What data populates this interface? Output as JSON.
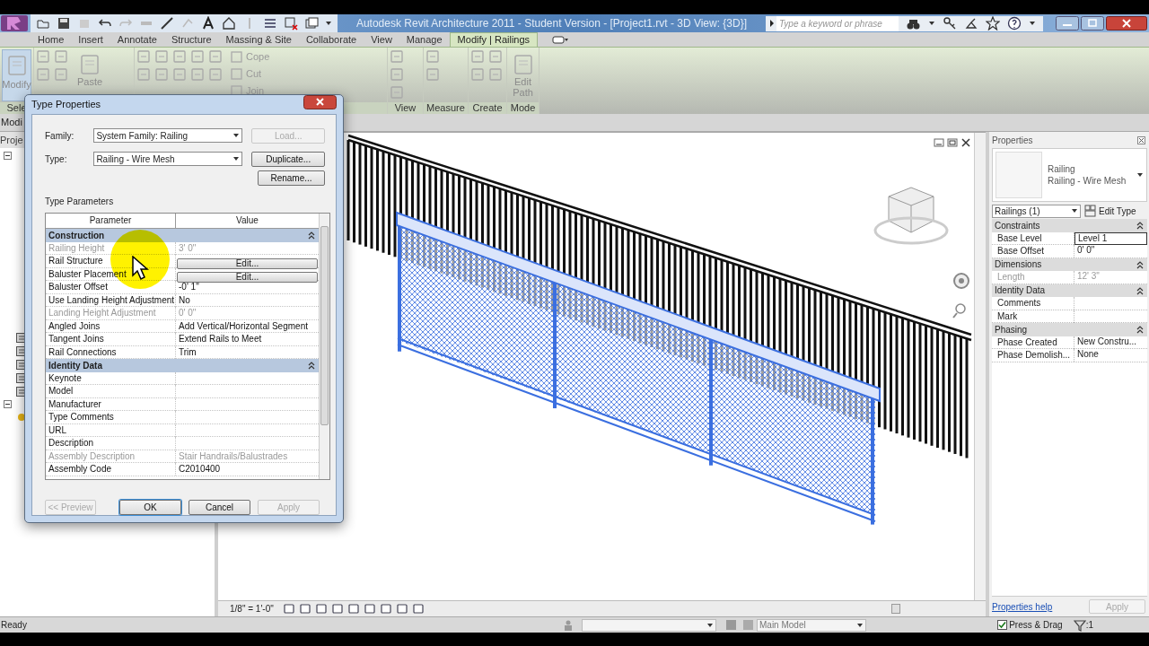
{
  "title_bar": {
    "title": "Autodesk Revit Architecture 2011 - Student Version - [Project1.rvt - 3D View: {3D}]",
    "search": {
      "placeholder": "Type a keyword or phrase"
    }
  },
  "ribbon": {
    "tabs": [
      {
        "label": "Home",
        "selected": false
      },
      {
        "label": "Insert",
        "selected": false
      },
      {
        "label": "Annotate",
        "selected": false
      },
      {
        "label": "Structure",
        "selected": false
      },
      {
        "label": "Massing & Site",
        "selected": false
      },
      {
        "label": "Collaborate",
        "selected": false
      },
      {
        "label": "View",
        "selected": false
      },
      {
        "label": "Manage",
        "selected": false
      },
      {
        "label": "Modify | Railings",
        "selected": true
      }
    ],
    "panels": [
      {
        "label": "Sele",
        "tools": [
          {
            "kind": "large",
            "label": "Modify"
          }
        ]
      },
      {
        "tools": [
          {
            "kind": "large",
            "label": "Paste"
          }
        ]
      },
      {
        "tools": [
          {
            "kind": "small",
            "label": "Cope"
          },
          {
            "kind": "small",
            "label": "Cut"
          },
          {
            "kind": "small",
            "label": "Join"
          }
        ]
      },
      {
        "label": "View"
      },
      {
        "label": "Measure"
      },
      {
        "label": "Create"
      },
      {
        "label": "Mode",
        "tools": [
          {
            "kind": "large",
            "label": "Edit Path"
          }
        ]
      }
    ]
  },
  "options_bar": {
    "label": "Modi"
  },
  "project_browser": {
    "title": "Proje"
  },
  "view": {
    "scale": "1/8\" = 1'-0\""
  },
  "type_properties": {
    "title": "Type Properties",
    "family": {
      "label": "Family:",
      "value": "System Family: Railing"
    },
    "type": {
      "label": "Type:",
      "value": "Railing - Wire Mesh"
    },
    "buttons": [
      {
        "label": "Load...",
        "disabled": true
      },
      {
        "label": "Duplicate...",
        "disabled": false
      },
      {
        "label": "Rename...",
        "disabled": false
      }
    ],
    "section_label": "Type Parameters",
    "columns": [
      "Parameter",
      "Value"
    ],
    "groups": [
      {
        "name": "Construction",
        "expanded": true,
        "rows": [
          {
            "parameter": "Railing Height",
            "value": "3' 0\"",
            "disabled": true,
            "kind": "text"
          },
          {
            "parameter": "Rail Structure",
            "value": "Edit...",
            "disabled": false,
            "kind": "button"
          },
          {
            "parameter": "Baluster Placement",
            "value": "Edit...",
            "disabled": false,
            "kind": "button"
          },
          {
            "parameter": "Baluster Offset",
            "value": "-0' 1\"",
            "disabled": false,
            "kind": "text"
          },
          {
            "parameter": "Use Landing Height Adjustment",
            "value": "No",
            "disabled": false,
            "kind": "text"
          },
          {
            "parameter": "Landing Height Adjustment",
            "value": "0' 0\"",
            "disabled": true,
            "kind": "text"
          },
          {
            "parameter": "Angled Joins",
            "value": "Add Vertical/Horizontal Segment",
            "disabled": false,
            "kind": "text"
          },
          {
            "parameter": "Tangent Joins",
            "value": "Extend Rails to Meet",
            "disabled": false,
            "kind": "text"
          },
          {
            "parameter": "Rail Connections",
            "value": "Trim",
            "disabled": false,
            "kind": "text"
          }
        ]
      },
      {
        "name": "Identity Data",
        "expanded": true,
        "rows": [
          {
            "parameter": "Keynote",
            "disabled": false,
            "kind": "text"
          },
          {
            "parameter": "Model",
            "disabled": false,
            "kind": "text"
          },
          {
            "parameter": "Manufacturer",
            "disabled": false,
            "kind": "text"
          },
          {
            "parameter": "Type Comments",
            "disabled": false,
            "kind": "text"
          },
          {
            "parameter": "URL",
            "disabled": false,
            "kind": "text"
          },
          {
            "parameter": "Description",
            "disabled": false,
            "kind": "text"
          },
          {
            "parameter": "Assembly Description",
            "value": "Stair Handrails/Balustrades",
            "disabled": true,
            "kind": "text"
          },
          {
            "parameter": "Assembly Code",
            "value": "C2010400",
            "disabled": false,
            "kind": "text"
          }
        ]
      }
    ],
    "footer": [
      {
        "label": "<< Preview",
        "disabled": true,
        "default": false
      },
      {
        "label": "OK",
        "disabled": false,
        "default": true
      },
      {
        "label": "Cancel",
        "disabled": false,
        "default": false
      },
      {
        "label": "Apply",
        "disabled": true,
        "default": false
      }
    ]
  },
  "properties": {
    "title": "Properties",
    "type_selector": {
      "family": "Railing",
      "type": "Railing - Wire Mesh"
    },
    "instance_filter": "Railings (1)",
    "edit_type": "Edit Type",
    "groups": [
      {
        "name": "Constraints",
        "expanded": true,
        "rows": [
          {
            "parameter": "Base Level",
            "value": "Level 1",
            "disabled": false,
            "editing": true
          },
          {
            "parameter": "Base Offset",
            "value": "0' 0\"",
            "disabled": false,
            "editing": false
          }
        ]
      },
      {
        "name": "Dimensions",
        "expanded": true,
        "rows": [
          {
            "parameter": "Length",
            "value": "12' 3\"",
            "disabled": true,
            "editing": false
          }
        ]
      },
      {
        "name": "Identity Data",
        "expanded": true,
        "rows": [
          {
            "parameter": "Comments",
            "disabled": false,
            "editing": false
          },
          {
            "parameter": "Mark",
            "disabled": false,
            "editing": false
          }
        ]
      },
      {
        "name": "Phasing",
        "expanded": true,
        "rows": [
          {
            "parameter": "Phase Created",
            "value": "New Constru...",
            "disabled": false,
            "editing": false
          },
          {
            "parameter": "Phase Demolish...",
            "value": "None",
            "disabled": false,
            "editing": false
          }
        ]
      }
    ],
    "help_link": "Properties help",
    "apply": {
      "label": "Apply",
      "disabled": true
    }
  },
  "status_bar": {
    "message": "Ready",
    "design_option": "Main Model",
    "press_drag": {
      "label": "Press & Drag",
      "checked": true
    },
    "filter_count": ":1"
  }
}
